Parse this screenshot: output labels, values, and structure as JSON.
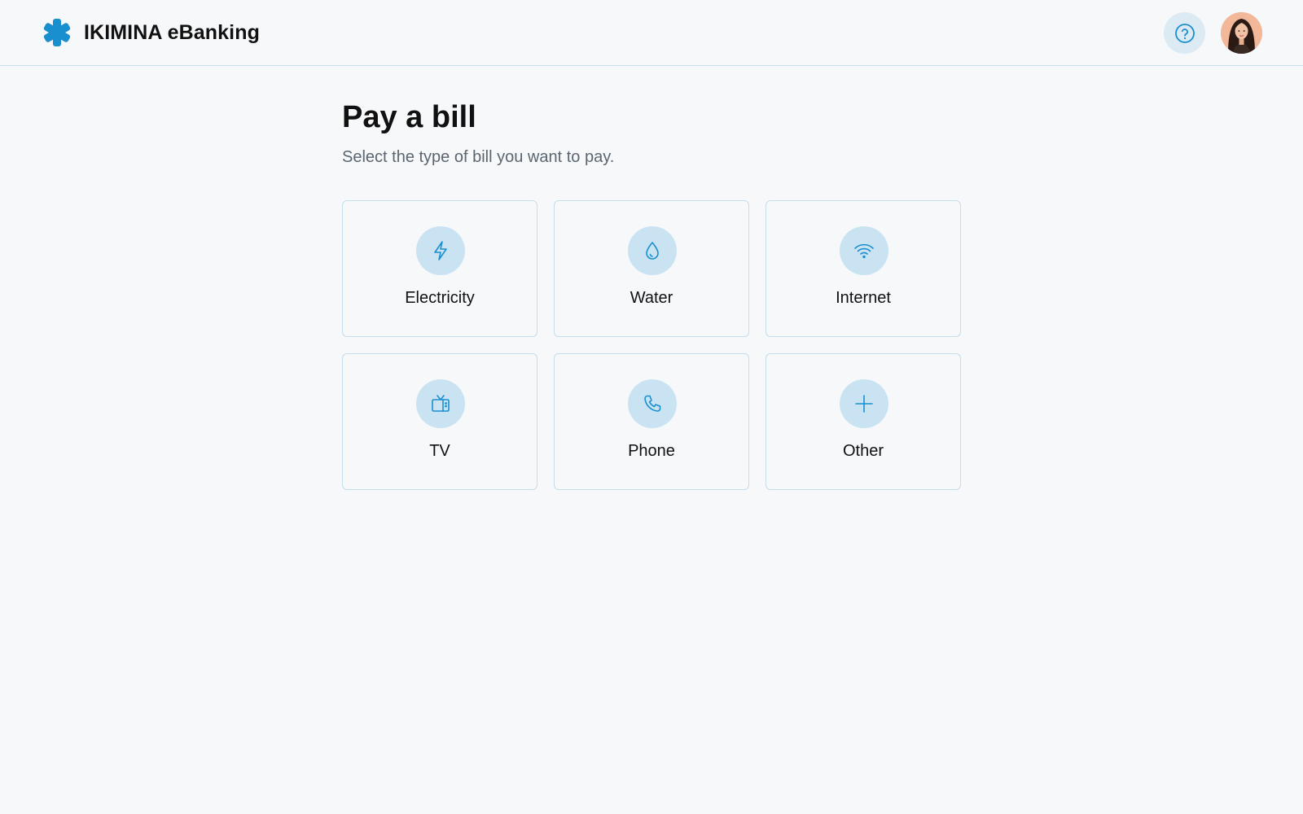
{
  "app": {
    "name": "IKIMINA eBanking",
    "logo_icon": "asterisk-logo-icon",
    "accent_color": "#1a8fd0"
  },
  "header": {
    "help_icon": "help-circle-icon",
    "avatar_icon": "user-avatar"
  },
  "page": {
    "title": "Pay a bill",
    "subtitle": "Select the type of bill you want to pay."
  },
  "bill_types": [
    {
      "label": "Electricity",
      "icon": "lightning-bolt-icon"
    },
    {
      "label": "Water",
      "icon": "water-drop-icon"
    },
    {
      "label": "Internet",
      "icon": "wifi-icon"
    },
    {
      "label": "TV",
      "icon": "tv-icon"
    },
    {
      "label": "Phone",
      "icon": "phone-icon"
    },
    {
      "label": "Other",
      "icon": "plus-icon"
    }
  ]
}
